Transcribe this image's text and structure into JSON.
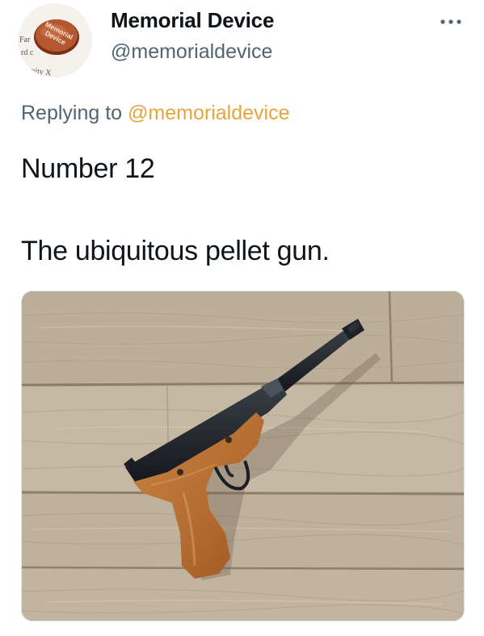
{
  "tweet": {
    "display_name": "Memorial Device",
    "handle": "@memorialdevice",
    "reply_prefix": "Replying to",
    "reply_mention": "@memorialdevice",
    "text_line_1": "Number 12",
    "text_line_2": "The ubiquitous pellet gun.",
    "more_icon": "more-horizontal-icon"
  },
  "avatar": {
    "badge_text_1": "Memorial",
    "badge_text_2": "Device",
    "paper_fragments": [
      "Far",
      "rd c",
      "nity X"
    ]
  },
  "colors": {
    "text_primary": "#0f1419",
    "text_secondary": "#536471",
    "mention": "#e8a33c"
  }
}
